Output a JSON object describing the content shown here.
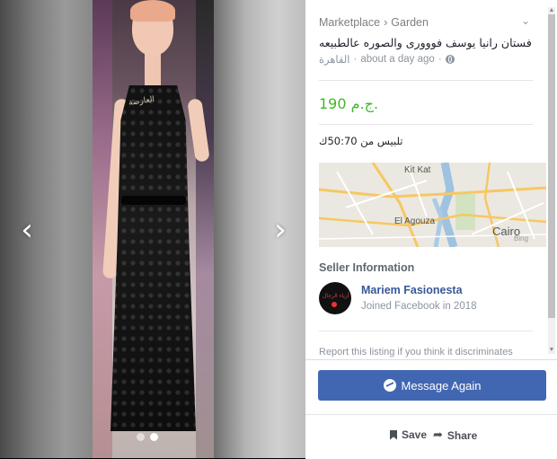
{
  "viewer": {
    "prev_arrow": "‹",
    "next_arrow": "›",
    "image_count": 2,
    "active_image": 2,
    "tag_text": "العارضة"
  },
  "listing": {
    "breadcrumb": [
      "Marketplace",
      "Garden"
    ],
    "breadcrumb_sep": "›",
    "title": "فستان رانيا يوسف فووورى والصوره عالطبيعه",
    "location": "القاهرة",
    "time": "about a day ago",
    "price": "190 ج.م.",
    "description": "تلبيس من 50:70ك",
    "map_labels": {
      "label1": "Kit Kat",
      "label2": "El Agouza",
      "label3": "Cairo",
      "label4": "Bing"
    }
  },
  "seller": {
    "heading": "Seller Information",
    "name": "Mariem Fasionesta",
    "joined": "Joined Facebook in 2018",
    "avatar_text": "أزياء الرجال"
  },
  "report_text": "Report this listing if you think it discriminates",
  "actions": {
    "message": "Message Again",
    "save": "Save",
    "share": "Share"
  },
  "colors": {
    "price": "#42b72a",
    "button": "#4267b2",
    "seller_name": "#385898"
  }
}
